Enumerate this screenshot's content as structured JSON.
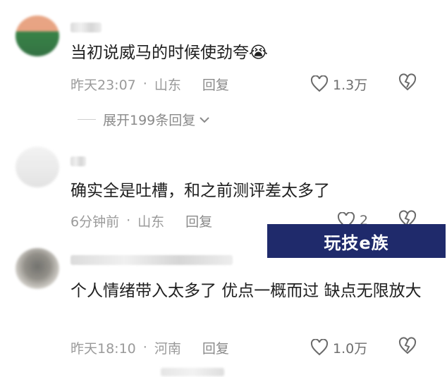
{
  "comments": [
    {
      "text": "当初说威马的时候使劲夸😭",
      "time": "昨天23:07",
      "location": "山东",
      "reply_label": "回复",
      "likes": "1.3万"
    },
    {
      "text": "确实全是吐槽，和之前测评差太多了",
      "time": "6分钟前",
      "location": "山东",
      "reply_label": "回复",
      "likes": "2"
    },
    {
      "text": "个人情绪带入太多了 优点一概而过 缺点无限放大",
      "time": "昨天18:10",
      "location": "河南",
      "reply_label": "回复",
      "likes": "1.0万"
    }
  ],
  "expand_replies": "展开199条回复",
  "separator": "·",
  "watermark": "玩技e族",
  "icons": [
    "heart-icon",
    "dislike-icon",
    "chevron-down-icon"
  ]
}
